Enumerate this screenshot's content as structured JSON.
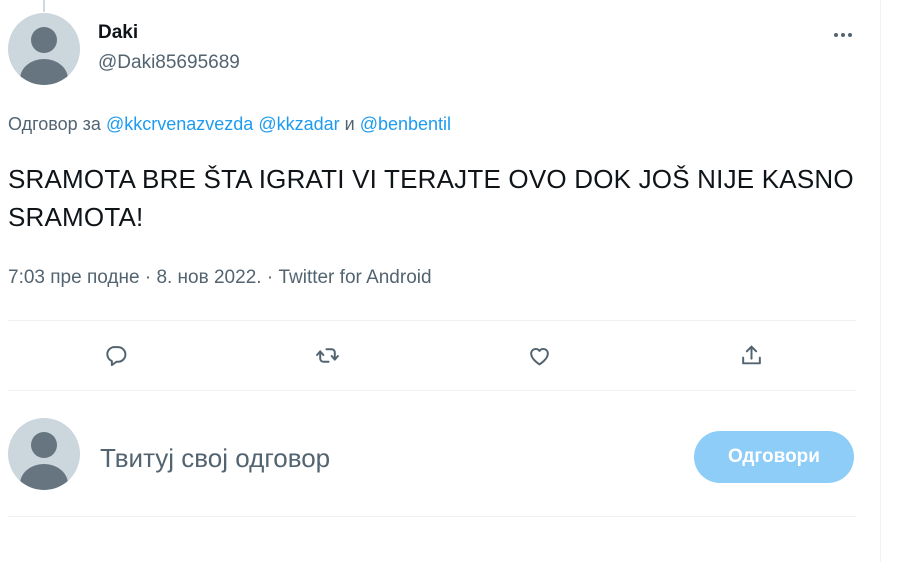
{
  "tweet": {
    "display_name": "Daki",
    "handle": "@Daki85695689",
    "reply_context": {
      "prefix": "Одговор за",
      "mentions": [
        "@kkcrvenazvezda",
        "@kkzadar",
        "@benbentil"
      ],
      "conjunction": "и"
    },
    "text": "SRAMOTA BRE ŠTA IGRATI VI TERAJTE OVO DOK JOŠ NIJE KASNO SRAMOTA!",
    "time": "7:03 пре подне",
    "date": "8. нов 2022.",
    "separator": "·",
    "source": "Twitter for Android"
  },
  "actions": [
    {
      "name": "reply",
      "icon": "reply-icon"
    },
    {
      "name": "retweet",
      "icon": "retweet-icon"
    },
    {
      "name": "like",
      "icon": "heart-icon"
    },
    {
      "name": "share",
      "icon": "share-icon"
    }
  ],
  "more_icon": "more-horizontal-icon",
  "composer": {
    "placeholder": "Твитуј свој одговор",
    "value": "",
    "button_label": "Одговори"
  },
  "colors": {
    "text": "#0f1419",
    "secondary": "#536471",
    "link": "#1d9bf0",
    "button_disabled": "#8ecdf8",
    "divider": "#eff3f4"
  }
}
